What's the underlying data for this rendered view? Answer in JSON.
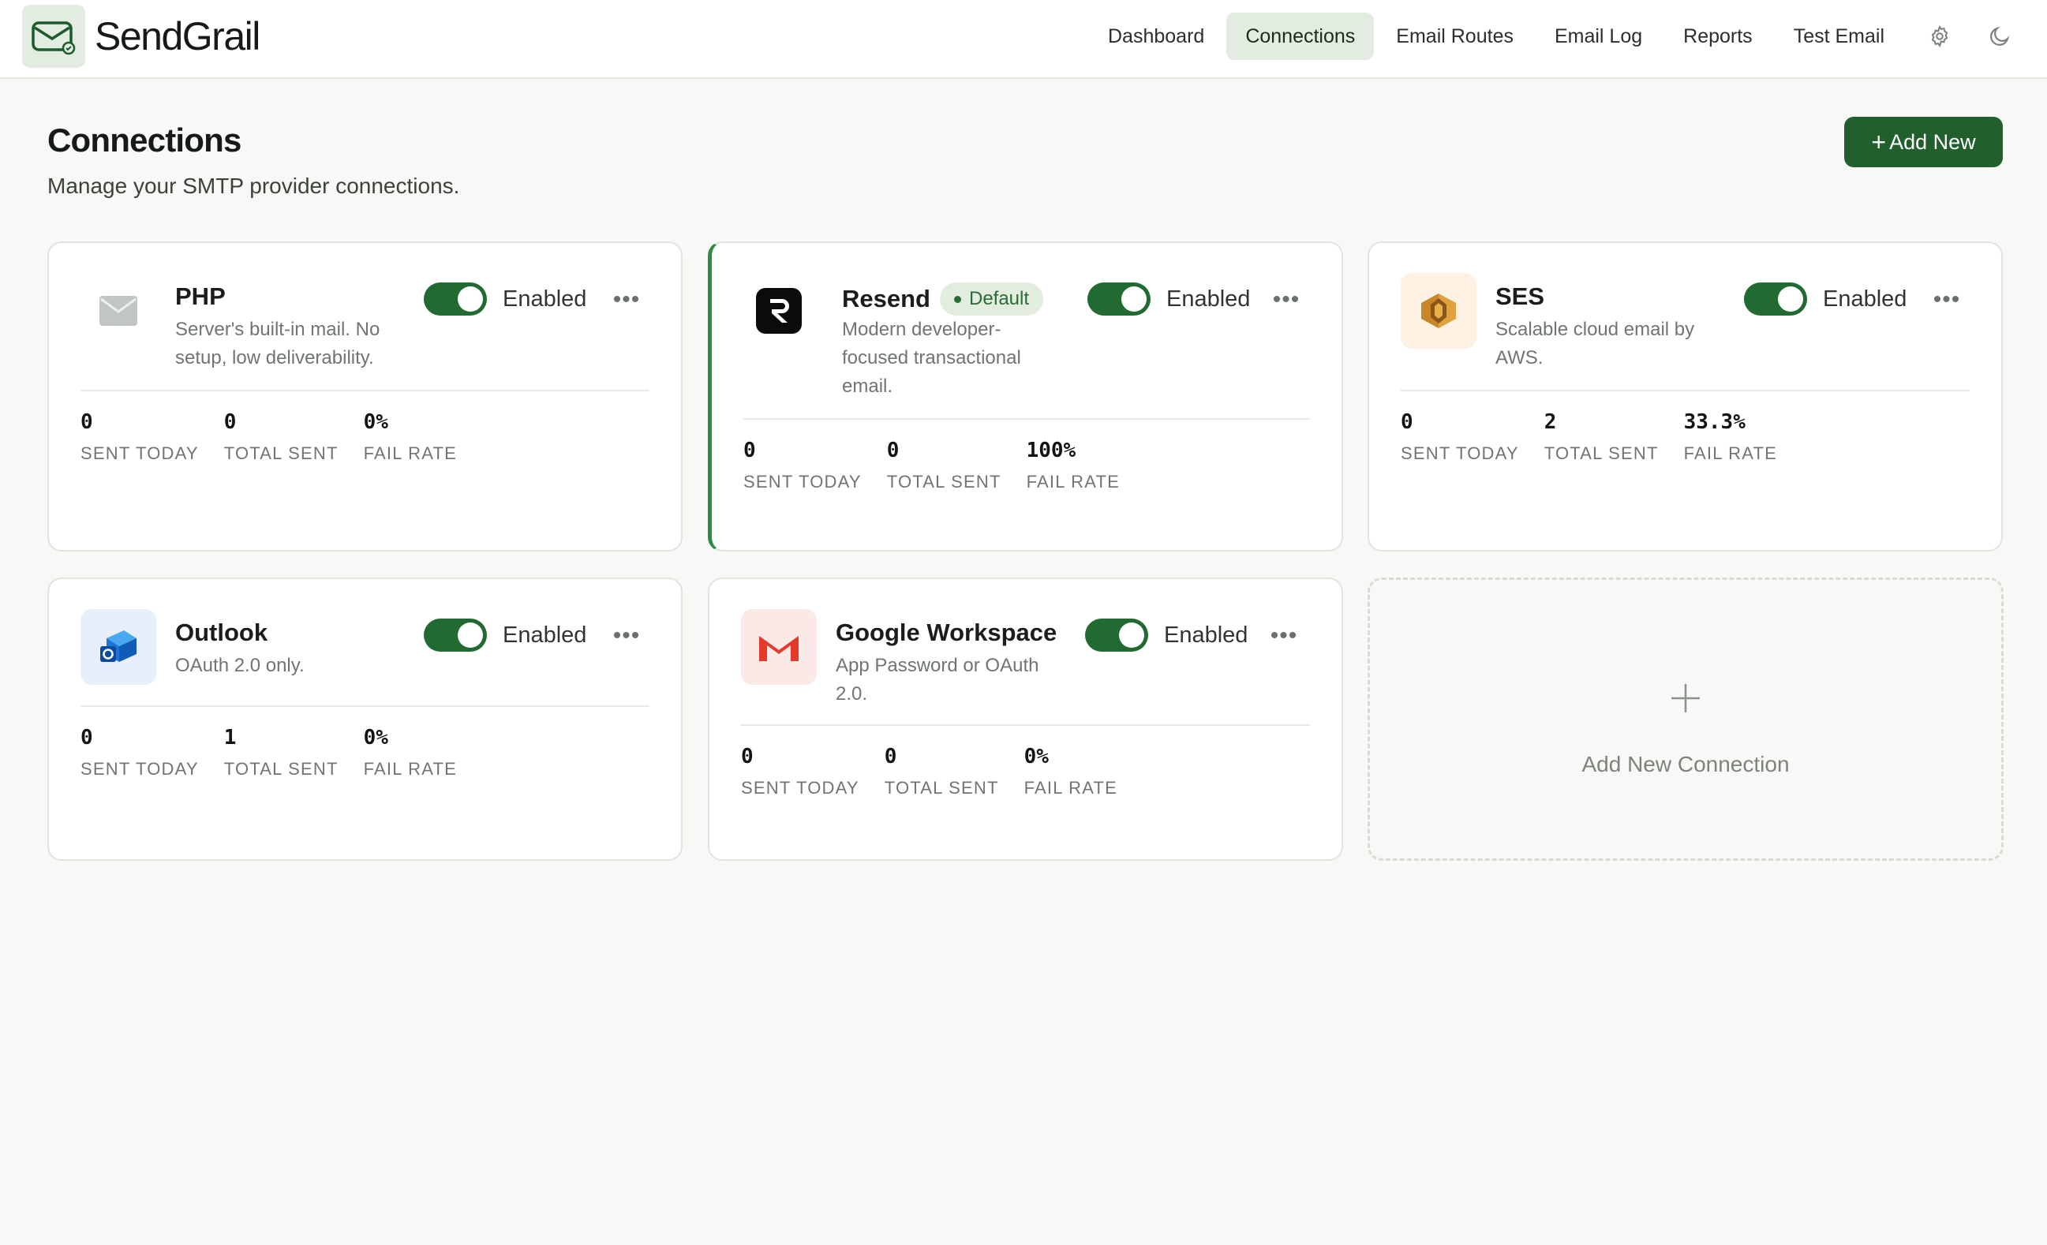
{
  "app": {
    "name": "SendGrail"
  },
  "nav": {
    "items": [
      {
        "label": "Dashboard",
        "active": false
      },
      {
        "label": "Connections",
        "active": true
      },
      {
        "label": "Email Routes",
        "active": false
      },
      {
        "label": "Email Log",
        "active": false
      },
      {
        "label": "Reports",
        "active": false
      },
      {
        "label": "Test Email",
        "active": false
      }
    ],
    "icons": [
      "gear-icon",
      "moon-icon"
    ]
  },
  "page": {
    "title": "Connections",
    "subtitle": "Manage your SMTP provider connections.",
    "add_button_label": "Add New"
  },
  "stat_labels": {
    "sent_today": "SENT TODAY",
    "total_sent": "TOTAL SENT",
    "fail_rate": "FAIL RATE"
  },
  "connections": [
    {
      "name": "PHP",
      "default": false,
      "description": "Server's built-in mail. No setup, low deliverability.",
      "icon": "envelope-icon",
      "enabled_label": "Enabled",
      "enabled": true,
      "sent_today": "0",
      "total_sent": "0",
      "fail_rate": "0%"
    },
    {
      "name": "Resend",
      "default": true,
      "badge": "Default",
      "description": "Modern developer-focused transactional email.",
      "icon": "resend-logo-icon",
      "enabled_label": "Enabled",
      "enabled": true,
      "sent_today": "0",
      "total_sent": "0",
      "fail_rate": "100%"
    },
    {
      "name": "SES",
      "default": false,
      "description": "Scalable cloud email by AWS.",
      "icon": "aws-ses-icon",
      "enabled_label": "Enabled",
      "enabled": true,
      "sent_today": "0",
      "total_sent": "2",
      "fail_rate": "33.3%"
    },
    {
      "name": "Outlook",
      "default": false,
      "description": "OAuth 2.0 only.",
      "icon": "outlook-icon",
      "enabled_label": "Enabled",
      "enabled": true,
      "sent_today": "0",
      "total_sent": "1",
      "fail_rate": "0%"
    },
    {
      "name": "Google Workspace",
      "default": false,
      "description": "App Password or OAuth 2.0.",
      "icon": "gmail-icon",
      "enabled_label": "Enabled",
      "enabled": true,
      "sent_today": "0",
      "total_sent": "0",
      "fail_rate": "0%"
    }
  ],
  "add_connection_label": "Add New Connection",
  "colors": {
    "accent": "#215f2d",
    "toggle_on": "#216a31",
    "default_border": "#2e8b43",
    "badge_bg": "#e2ede0"
  }
}
